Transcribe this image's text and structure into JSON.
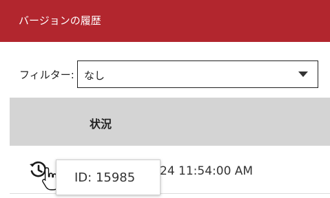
{
  "header": {
    "title": "バージョンの履歴"
  },
  "filter": {
    "label": "フィルター:",
    "selected": "なし"
  },
  "table": {
    "columns": [
      "",
      "状況"
    ],
    "rows": [
      {
        "date_visible": "24 11:54:00 AM"
      }
    ]
  },
  "tooltip": {
    "text": "ID: 15985"
  },
  "icons": {
    "history": "history-icon",
    "caret": "chevron-down-icon",
    "cursor": "hand-pointer-icon"
  },
  "colors": {
    "header_bg": "#b2262e",
    "table_header_bg": "#d4d4d4"
  }
}
